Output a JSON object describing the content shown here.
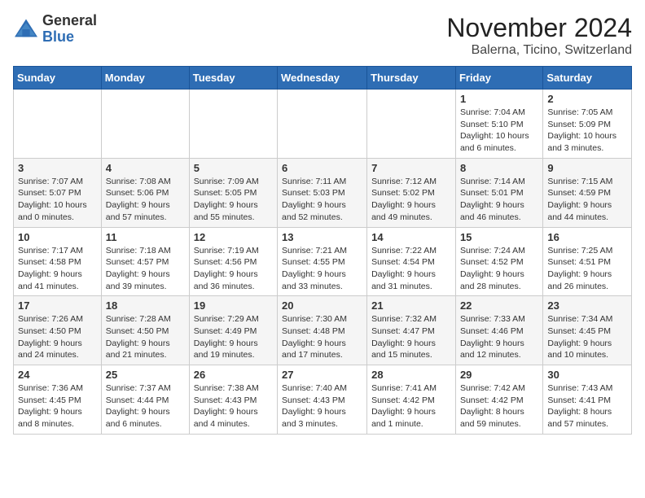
{
  "logo": {
    "general": "General",
    "blue": "Blue"
  },
  "title": "November 2024",
  "location": "Balerna, Ticino, Switzerland",
  "weekdays": [
    "Sunday",
    "Monday",
    "Tuesday",
    "Wednesday",
    "Thursday",
    "Friday",
    "Saturday"
  ],
  "weeks": [
    [
      {
        "day": "",
        "info": ""
      },
      {
        "day": "",
        "info": ""
      },
      {
        "day": "",
        "info": ""
      },
      {
        "day": "",
        "info": ""
      },
      {
        "day": "",
        "info": ""
      },
      {
        "day": "1",
        "info": "Sunrise: 7:04 AM\nSunset: 5:10 PM\nDaylight: 10 hours and 6 minutes."
      },
      {
        "day": "2",
        "info": "Sunrise: 7:05 AM\nSunset: 5:09 PM\nDaylight: 10 hours and 3 minutes."
      }
    ],
    [
      {
        "day": "3",
        "info": "Sunrise: 7:07 AM\nSunset: 5:07 PM\nDaylight: 10 hours and 0 minutes."
      },
      {
        "day": "4",
        "info": "Sunrise: 7:08 AM\nSunset: 5:06 PM\nDaylight: 9 hours and 57 minutes."
      },
      {
        "day": "5",
        "info": "Sunrise: 7:09 AM\nSunset: 5:05 PM\nDaylight: 9 hours and 55 minutes."
      },
      {
        "day": "6",
        "info": "Sunrise: 7:11 AM\nSunset: 5:03 PM\nDaylight: 9 hours and 52 minutes."
      },
      {
        "day": "7",
        "info": "Sunrise: 7:12 AM\nSunset: 5:02 PM\nDaylight: 9 hours and 49 minutes."
      },
      {
        "day": "8",
        "info": "Sunrise: 7:14 AM\nSunset: 5:01 PM\nDaylight: 9 hours and 46 minutes."
      },
      {
        "day": "9",
        "info": "Sunrise: 7:15 AM\nSunset: 4:59 PM\nDaylight: 9 hours and 44 minutes."
      }
    ],
    [
      {
        "day": "10",
        "info": "Sunrise: 7:17 AM\nSunset: 4:58 PM\nDaylight: 9 hours and 41 minutes."
      },
      {
        "day": "11",
        "info": "Sunrise: 7:18 AM\nSunset: 4:57 PM\nDaylight: 9 hours and 39 minutes."
      },
      {
        "day": "12",
        "info": "Sunrise: 7:19 AM\nSunset: 4:56 PM\nDaylight: 9 hours and 36 minutes."
      },
      {
        "day": "13",
        "info": "Sunrise: 7:21 AM\nSunset: 4:55 PM\nDaylight: 9 hours and 33 minutes."
      },
      {
        "day": "14",
        "info": "Sunrise: 7:22 AM\nSunset: 4:54 PM\nDaylight: 9 hours and 31 minutes."
      },
      {
        "day": "15",
        "info": "Sunrise: 7:24 AM\nSunset: 4:52 PM\nDaylight: 9 hours and 28 minutes."
      },
      {
        "day": "16",
        "info": "Sunrise: 7:25 AM\nSunset: 4:51 PM\nDaylight: 9 hours and 26 minutes."
      }
    ],
    [
      {
        "day": "17",
        "info": "Sunrise: 7:26 AM\nSunset: 4:50 PM\nDaylight: 9 hours and 24 minutes."
      },
      {
        "day": "18",
        "info": "Sunrise: 7:28 AM\nSunset: 4:50 PM\nDaylight: 9 hours and 21 minutes."
      },
      {
        "day": "19",
        "info": "Sunrise: 7:29 AM\nSunset: 4:49 PM\nDaylight: 9 hours and 19 minutes."
      },
      {
        "day": "20",
        "info": "Sunrise: 7:30 AM\nSunset: 4:48 PM\nDaylight: 9 hours and 17 minutes."
      },
      {
        "day": "21",
        "info": "Sunrise: 7:32 AM\nSunset: 4:47 PM\nDaylight: 9 hours and 15 minutes."
      },
      {
        "day": "22",
        "info": "Sunrise: 7:33 AM\nSunset: 4:46 PM\nDaylight: 9 hours and 12 minutes."
      },
      {
        "day": "23",
        "info": "Sunrise: 7:34 AM\nSunset: 4:45 PM\nDaylight: 9 hours and 10 minutes."
      }
    ],
    [
      {
        "day": "24",
        "info": "Sunrise: 7:36 AM\nSunset: 4:45 PM\nDaylight: 9 hours and 8 minutes."
      },
      {
        "day": "25",
        "info": "Sunrise: 7:37 AM\nSunset: 4:44 PM\nDaylight: 9 hours and 6 minutes."
      },
      {
        "day": "26",
        "info": "Sunrise: 7:38 AM\nSunset: 4:43 PM\nDaylight: 9 hours and 4 minutes."
      },
      {
        "day": "27",
        "info": "Sunrise: 7:40 AM\nSunset: 4:43 PM\nDaylight: 9 hours and 3 minutes."
      },
      {
        "day": "28",
        "info": "Sunrise: 7:41 AM\nSunset: 4:42 PM\nDaylight: 9 hours and 1 minute."
      },
      {
        "day": "29",
        "info": "Sunrise: 7:42 AM\nSunset: 4:42 PM\nDaylight: 8 hours and 59 minutes."
      },
      {
        "day": "30",
        "info": "Sunrise: 7:43 AM\nSunset: 4:41 PM\nDaylight: 8 hours and 57 minutes."
      }
    ]
  ]
}
